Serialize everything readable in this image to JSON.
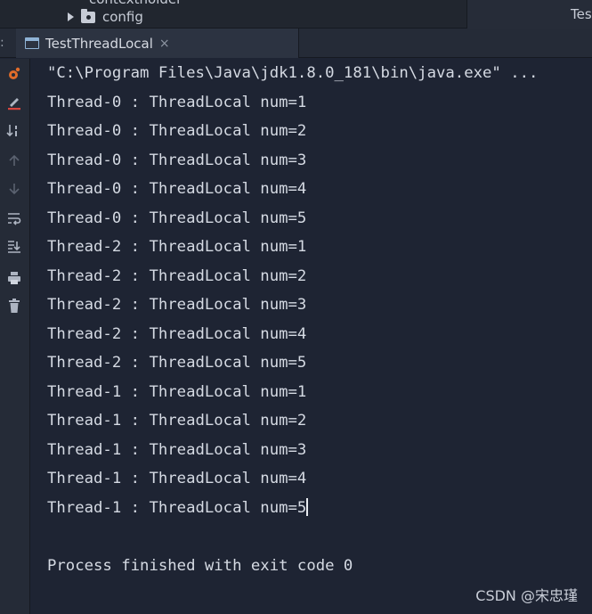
{
  "project_tree": {
    "items": [
      {
        "label": "contextholder"
      },
      {
        "label": "config"
      }
    ],
    "right_panel_label": "Tes"
  },
  "tabs": [
    {
      "label": "TestThreadLocal",
      "close": "×"
    }
  ],
  "toolbar_edge": ":",
  "toolbar": [
    "run-icon",
    "edit-icon",
    "sort-icon",
    "up-arrow-icon",
    "down-arrow-icon",
    "soft-wrap-icon",
    "scroll-to-end-icon",
    "print-icon",
    "trash-icon"
  ],
  "console": {
    "command": "\"C:\\Program Files\\Java\\jdk1.8.0_181\\bin\\java.exe\" ...",
    "lines": [
      "Thread-0 : ThreadLocal num=1",
      "Thread-0 : ThreadLocal num=2",
      "Thread-0 : ThreadLocal num=3",
      "Thread-0 : ThreadLocal num=4",
      "Thread-0 : ThreadLocal num=5",
      "Thread-2 : ThreadLocal num=1",
      "Thread-2 : ThreadLocal num=2",
      "Thread-2 : ThreadLocal num=3",
      "Thread-2 : ThreadLocal num=4",
      "Thread-2 : ThreadLocal num=5",
      "Thread-1 : ThreadLocal num=1",
      "Thread-1 : ThreadLocal num=2",
      "Thread-1 : ThreadLocal num=3",
      "Thread-1 : ThreadLocal num=4",
      "Thread-1 : ThreadLocal num=5"
    ],
    "exit_message": "Process finished with exit code 0"
  },
  "watermark": "CSDN @宋忠瑾",
  "colors": {
    "background": "#1e2433",
    "text": "#d5dae3",
    "run_icon": "#e06c2a",
    "edit_icon_accent": "#d9463f"
  }
}
